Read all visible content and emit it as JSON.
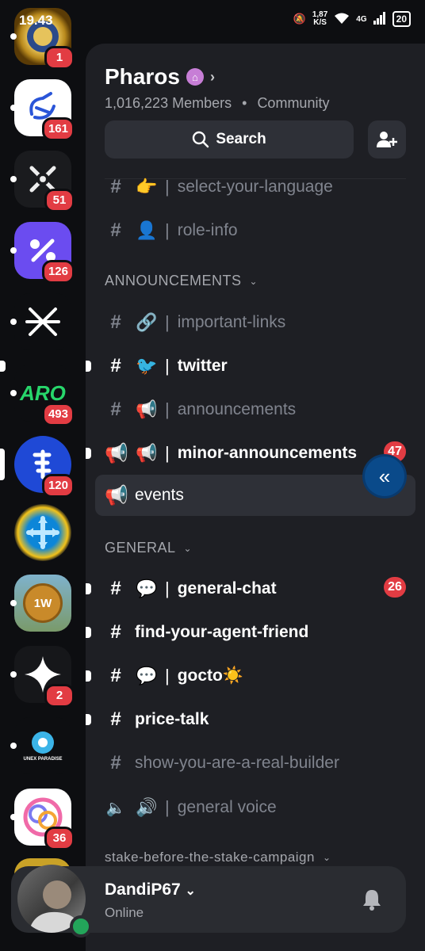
{
  "status_bar": {
    "time": "19.43",
    "speed": "1,87",
    "speed_unit": "K/S",
    "network": "4G",
    "battery": "20"
  },
  "rail": {
    "servers": [
      {
        "name": "server-1",
        "badge": "1"
      },
      {
        "name": "server-2",
        "badge": "161"
      },
      {
        "name": "server-3",
        "badge": "51"
      },
      {
        "name": "server-4",
        "badge": "126"
      },
      {
        "name": "server-5",
        "badge": ""
      },
      {
        "name": "server-aro",
        "label": "ARO",
        "badge": "493"
      },
      {
        "name": "server-pharos",
        "badge": "120"
      },
      {
        "name": "server-8",
        "badge": ""
      },
      {
        "name": "server-9",
        "label": "1W",
        "badge": ""
      },
      {
        "name": "server-10",
        "badge": "2"
      },
      {
        "name": "server-unex",
        "label": "UNEX PARADISE",
        "badge": ""
      },
      {
        "name": "server-12",
        "badge": "36"
      }
    ]
  },
  "server": {
    "name": "Pharos",
    "members": "1,016,223 Members",
    "separator": "•",
    "type": "Community",
    "search_label": "Search"
  },
  "channels": {
    "top": [
      {
        "emoji": "👉",
        "name": "select-your-language",
        "unread": false
      },
      {
        "emoji": "👤",
        "name": "role-info",
        "unread": false
      }
    ],
    "announcements_label": "ANNOUNCEMENTS",
    "announcements": [
      {
        "emoji": "🔗",
        "name": "important-links",
        "unread": false
      },
      {
        "emoji": "🐦",
        "name": "twitter",
        "unread": true
      },
      {
        "emoji": "📢",
        "name": "announcements",
        "unread": false
      },
      {
        "emoji": "📢",
        "name": "minor-announcements",
        "unread": true,
        "badge": "47"
      },
      {
        "emoji": "",
        "name": "events",
        "unread": false
      }
    ],
    "general_label": "GENERAL",
    "general": [
      {
        "emoji": "💬",
        "name": "general-chat",
        "unread": true,
        "badge": "26"
      },
      {
        "emoji": "",
        "name": "find-your-agent-friend",
        "unread": true
      },
      {
        "emoji": "💬",
        "name": "gocto☀️",
        "unread": true
      },
      {
        "emoji": "",
        "name": "price-talk",
        "unread": true
      },
      {
        "emoji": "",
        "name": "show-you-are-a-real-builder",
        "unread": false
      },
      {
        "emoji": "🔊",
        "name": "general voice",
        "unread": false
      }
    ],
    "next_category": "stake-before-the-stake-campaign"
  },
  "user": {
    "name": "DandiP67",
    "status": "Online"
  },
  "colors": {
    "accent_badge": "#e23c43",
    "online": "#23a55a",
    "panel": "#1e1f24"
  }
}
